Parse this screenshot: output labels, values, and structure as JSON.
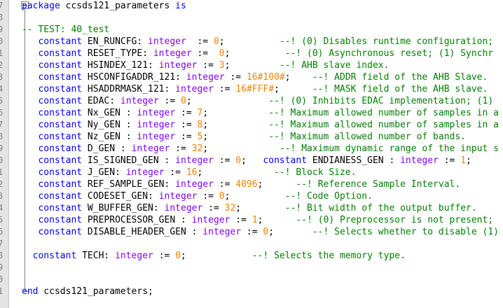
{
  "editor": {
    "line_numbers": [
      "7",
      "8",
      "9",
      "0",
      "1",
      "2",
      "3",
      "4",
      "5",
      "6",
      "7",
      "8",
      "9",
      "0",
      "1",
      "2",
      "3",
      "4",
      "5",
      "6",
      "7",
      "8",
      "9",
      "0",
      "1"
    ],
    "lines": [
      [
        {
          "c": "kw",
          "t": "package"
        },
        {
          "c": "id",
          "t": " ccsds121_parameters "
        },
        {
          "c": "kw",
          "t": "is"
        }
      ],
      [],
      [
        {
          "c": "cm",
          "t": "-- TEST: 40_test"
        }
      ],
      [
        {
          "c": "id",
          "t": "   "
        },
        {
          "c": "kw",
          "t": "constant"
        },
        {
          "c": "id",
          "t": " EN_RUNCFG: "
        },
        {
          "c": "ty",
          "t": "integer"
        },
        {
          "c": "id",
          "t": "  := "
        },
        {
          "c": "nm",
          "t": "0"
        },
        {
          "c": "id",
          "t": ";          "
        },
        {
          "c": "cm",
          "t": "--! (0) Disables runtime configuration;"
        }
      ],
      [
        {
          "c": "id",
          "t": "   "
        },
        {
          "c": "kw",
          "t": "constant"
        },
        {
          "c": "id",
          "t": " RESET_TYPE: "
        },
        {
          "c": "ty",
          "t": "integer"
        },
        {
          "c": "id",
          "t": " :=  "
        },
        {
          "c": "nm",
          "t": "0"
        },
        {
          "c": "id",
          "t": ";          "
        },
        {
          "c": "cm",
          "t": "--! (0) Asynchronous reset; (1) Synchr"
        }
      ],
      [
        {
          "c": "id",
          "t": "   "
        },
        {
          "c": "kw",
          "t": "constant"
        },
        {
          "c": "id",
          "t": " HSINDEX_121: "
        },
        {
          "c": "ty",
          "t": "integer"
        },
        {
          "c": "id",
          "t": " := "
        },
        {
          "c": "nm",
          "t": "3"
        },
        {
          "c": "id",
          "t": ";         "
        },
        {
          "c": "cm",
          "t": "--! AHB slave index."
        }
      ],
      [
        {
          "c": "id",
          "t": "   "
        },
        {
          "c": "kw",
          "t": "constant"
        },
        {
          "c": "id",
          "t": " HSCONFIGADDR_121: "
        },
        {
          "c": "ty",
          "t": "integer"
        },
        {
          "c": "id",
          "t": " := "
        },
        {
          "c": "nm",
          "t": "16#100#"
        },
        {
          "c": "id",
          "t": ";    "
        },
        {
          "c": "cm",
          "t": "--! ADDR field of the AHB Slave."
        }
      ],
      [
        {
          "c": "id",
          "t": "   "
        },
        {
          "c": "kw",
          "t": "constant"
        },
        {
          "c": "id",
          "t": " HSADDRMASK_121: "
        },
        {
          "c": "ty",
          "t": "integer"
        },
        {
          "c": "id",
          "t": " := "
        },
        {
          "c": "nm",
          "t": "16#FFF#"
        },
        {
          "c": "id",
          "t": ";      "
        },
        {
          "c": "cm",
          "t": "--! MASK field of the AHB slave."
        }
      ],
      [
        {
          "c": "id",
          "t": "   "
        },
        {
          "c": "kw",
          "t": "constant"
        },
        {
          "c": "id",
          "t": " EDAC: "
        },
        {
          "c": "ty",
          "t": "integer"
        },
        {
          "c": "id",
          "t": " := "
        },
        {
          "c": "nm",
          "t": "0"
        },
        {
          "c": "id",
          "t": ";              "
        },
        {
          "c": "cm",
          "t": "--! (0) Inhibits EDAC implementation; (1)"
        }
      ],
      [
        {
          "c": "id",
          "t": "   "
        },
        {
          "c": "kw",
          "t": "constant"
        },
        {
          "c": "id",
          "t": " Nx_GEN : "
        },
        {
          "c": "ty",
          "t": "integer"
        },
        {
          "c": "id",
          "t": " := "
        },
        {
          "c": "nm",
          "t": "7"
        },
        {
          "c": "id",
          "t": ";           "
        },
        {
          "c": "cm",
          "t": "--! Maximum allowed number of samples in a"
        }
      ],
      [
        {
          "c": "id",
          "t": "   "
        },
        {
          "c": "kw",
          "t": "constant"
        },
        {
          "c": "id",
          "t": " Ny_GEN : "
        },
        {
          "c": "ty",
          "t": "integer"
        },
        {
          "c": "id",
          "t": " := "
        },
        {
          "c": "nm",
          "t": "8"
        },
        {
          "c": "id",
          "t": ";           "
        },
        {
          "c": "cm",
          "t": "--! Maximum allowed number of samples in a"
        }
      ],
      [
        {
          "c": "id",
          "t": "   "
        },
        {
          "c": "kw",
          "t": "constant"
        },
        {
          "c": "id",
          "t": " Nz_GEN : "
        },
        {
          "c": "ty",
          "t": "integer"
        },
        {
          "c": "id",
          "t": " := "
        },
        {
          "c": "nm",
          "t": "5"
        },
        {
          "c": "id",
          "t": ";           "
        },
        {
          "c": "cm",
          "t": "--! Maximum allowed number of bands."
        }
      ],
      [
        {
          "c": "id",
          "t": "   "
        },
        {
          "c": "kw",
          "t": "constant"
        },
        {
          "c": "id",
          "t": " D_GEN : "
        },
        {
          "c": "ty",
          "t": "integer"
        },
        {
          "c": "id",
          "t": " := "
        },
        {
          "c": "nm",
          "t": "32"
        },
        {
          "c": "id",
          "t": ";             "
        },
        {
          "c": "cm",
          "t": "--! Maximum dynamic range of the input s"
        }
      ],
      [
        {
          "c": "id",
          "t": "   "
        },
        {
          "c": "kw",
          "t": "constant"
        },
        {
          "c": "id",
          "t": " IS_SIGNED_GEN : "
        },
        {
          "c": "ty",
          "t": "integer"
        },
        {
          "c": "id",
          "t": " := "
        },
        {
          "c": "nm",
          "t": "0"
        },
        {
          "c": "id",
          "t": ";   "
        },
        {
          "c": "kw",
          "t": "constant"
        },
        {
          "c": "id",
          "t": " ENDIANESS_GEN : "
        },
        {
          "c": "ty",
          "t": "integer"
        },
        {
          "c": "id",
          "t": " := "
        },
        {
          "c": "nm",
          "t": "1"
        },
        {
          "c": "id",
          "t": ";"
        }
      ],
      [
        {
          "c": "id",
          "t": "   "
        },
        {
          "c": "kw",
          "t": "constant"
        },
        {
          "c": "id",
          "t": " J_GEN: "
        },
        {
          "c": "ty",
          "t": "integer"
        },
        {
          "c": "id",
          "t": " := "
        },
        {
          "c": "nm",
          "t": "16"
        },
        {
          "c": "id",
          "t": ";             "
        },
        {
          "c": "cm",
          "t": "--! Block Size."
        }
      ],
      [
        {
          "c": "id",
          "t": "   "
        },
        {
          "c": "kw",
          "t": "constant"
        },
        {
          "c": "id",
          "t": " REF_SAMPLE_GEN: "
        },
        {
          "c": "ty",
          "t": "integer"
        },
        {
          "c": "id",
          "t": " := "
        },
        {
          "c": "nm",
          "t": "4096"
        },
        {
          "c": "id",
          "t": ";      "
        },
        {
          "c": "cm",
          "t": "--! Reference Sample Interval."
        }
      ],
      [
        {
          "c": "id",
          "t": "   "
        },
        {
          "c": "kw",
          "t": "constant"
        },
        {
          "c": "id",
          "t": " CODESET_GEN: "
        },
        {
          "c": "ty",
          "t": "integer"
        },
        {
          "c": "id",
          "t": " := "
        },
        {
          "c": "nm",
          "t": "0"
        },
        {
          "c": "id",
          "t": ";          "
        },
        {
          "c": "cm",
          "t": "--! Code Option."
        }
      ],
      [
        {
          "c": "id",
          "t": "   "
        },
        {
          "c": "kw",
          "t": "constant"
        },
        {
          "c": "id",
          "t": " W_BUFFER_GEN: "
        },
        {
          "c": "ty",
          "t": "integer"
        },
        {
          "c": "id",
          "t": " := "
        },
        {
          "c": "nm",
          "t": "32"
        },
        {
          "c": "id",
          "t": ";        "
        },
        {
          "c": "cm",
          "t": "--! Bit width of the output buffer."
        }
      ],
      [
        {
          "c": "id",
          "t": "   "
        },
        {
          "c": "kw",
          "t": "constant"
        },
        {
          "c": "id",
          "t": " PREPROCESSOR_GEN : "
        },
        {
          "c": "ty",
          "t": "integer"
        },
        {
          "c": "id",
          "t": " := "
        },
        {
          "c": "nm",
          "t": "1"
        },
        {
          "c": "id",
          "t": ";      "
        },
        {
          "c": "cm",
          "t": "--! (0) Preprocessor is not present;"
        }
      ],
      [
        {
          "c": "id",
          "t": "   "
        },
        {
          "c": "kw",
          "t": "constant"
        },
        {
          "c": "id",
          "t": " DISABLE_HEADER_GEN : "
        },
        {
          "c": "ty",
          "t": "integer"
        },
        {
          "c": "id",
          "t": " := "
        },
        {
          "c": "nm",
          "t": "0"
        },
        {
          "c": "id",
          "t": ";       "
        },
        {
          "c": "cm",
          "t": "--! Selects whether to disable (1)"
        }
      ],
      [],
      [
        {
          "c": "id",
          "t": "  "
        },
        {
          "c": "kw",
          "t": "constant"
        },
        {
          "c": "id",
          "t": " TECH: "
        },
        {
          "c": "ty",
          "t": "integer"
        },
        {
          "c": "id",
          "t": " := "
        },
        {
          "c": "nm",
          "t": "0"
        },
        {
          "c": "id",
          "t": ";            "
        },
        {
          "c": "cm",
          "t": "--! Selects the memory type."
        }
      ],
      [],
      [],
      [
        {
          "c": "kw",
          "t": "end"
        },
        {
          "c": "id",
          "t": " ccsds121_parameters;"
        }
      ]
    ]
  }
}
